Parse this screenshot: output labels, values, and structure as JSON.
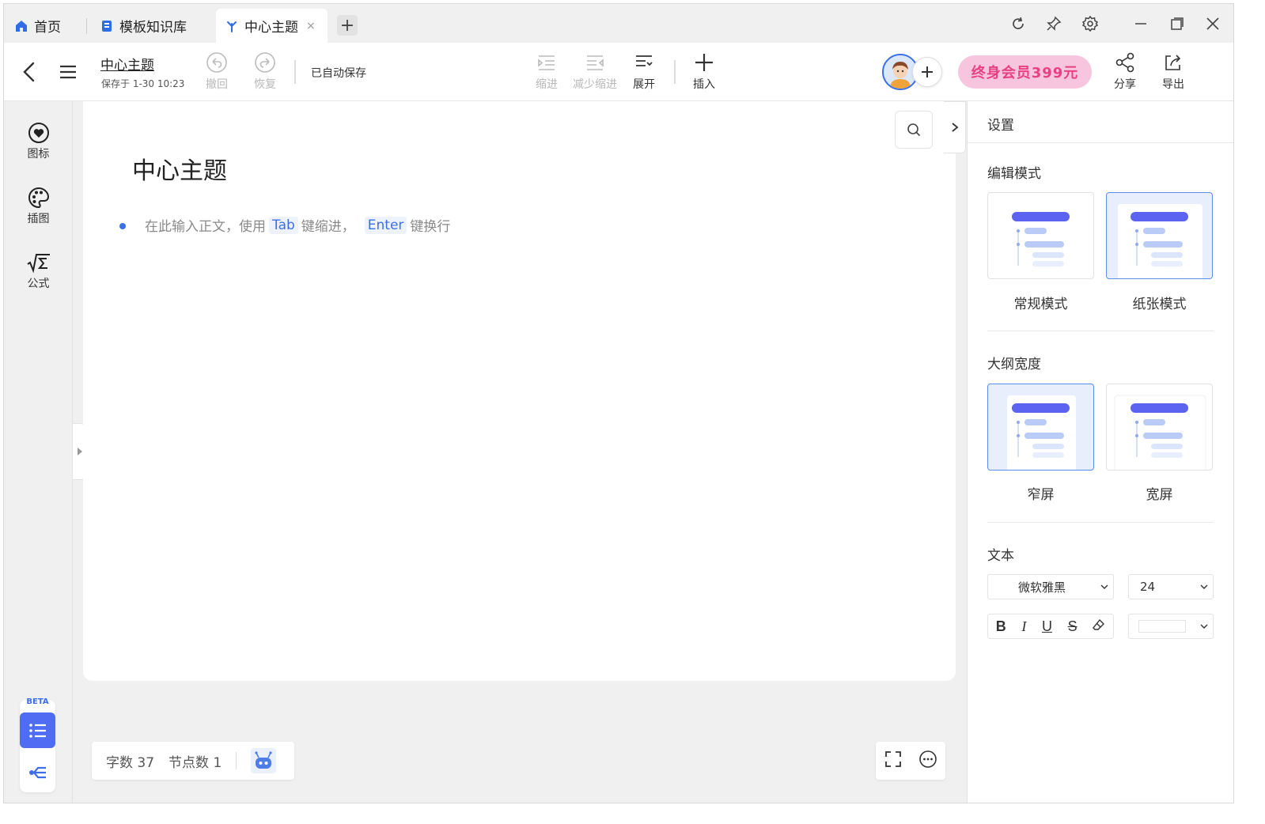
{
  "tabs": [
    {
      "label": "首页",
      "icon": "home-icon"
    },
    {
      "label": "模板知识库",
      "icon": "template-library-icon"
    },
    {
      "label": "中心主题",
      "icon": "mindmap-file-icon",
      "active": true
    }
  ],
  "toolbar": {
    "doc_title": "中心主题",
    "saved_at": "保存于 1-30 10:23",
    "undo": "撤回",
    "redo": "恢复",
    "autosave": "已自动保存",
    "indent": "缩进",
    "outdent": "减少缩进",
    "expand": "展开",
    "insert": "插入",
    "promo": "终身会员399元",
    "share": "分享",
    "export": "导出"
  },
  "rail": {
    "icons_label": "图标",
    "illustration_label": "插图",
    "formula_label": "公式",
    "beta_badge": "BETA"
  },
  "canvas": {
    "title": "中心主题",
    "placeholder_prefix": "在此输入正文，使用",
    "key_tab": "Tab",
    "placeholder_mid": "键缩进，",
    "key_enter": "Enter",
    "placeholder_suffix": "键换行"
  },
  "status": {
    "word_count_label": "字数 37",
    "node_count_label": "节点数 1"
  },
  "panel": {
    "title": "设置",
    "edit_mode_heading": "编辑模式",
    "edit_modes": [
      "常规模式",
      "纸张模式"
    ],
    "edit_mode_selected": "纸张模式",
    "width_heading": "大纲宽度",
    "widths": [
      "窄屏",
      "宽屏"
    ],
    "width_selected": "窄屏",
    "text_heading": "文本",
    "font_family": "微软雅黑",
    "font_size": "24"
  },
  "colors": {
    "accent": "#3b6fe8",
    "mode_bar": "#5b63f0",
    "promo_bg": "#f7c6de",
    "promo_text": "#e8417f"
  }
}
